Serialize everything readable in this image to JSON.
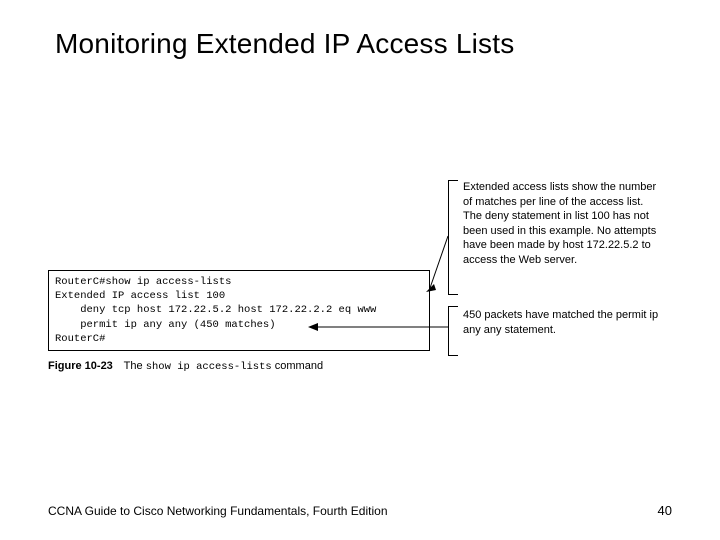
{
  "title": "Monitoring Extended IP Access Lists",
  "terminal": {
    "l1": "RouterC#show ip access-lists",
    "l2": "Extended IP access list 100",
    "l3": "    deny tcp host 172.22.5.2 host 172.22.2.2 eq www",
    "l4": "    permit ip any any (450 matches)",
    "l5": "RouterC#"
  },
  "annotations": {
    "top": "Extended access lists show the number of matches per line of the access list. The deny statement in list 100 has not been used in this example. No attempts have been made by host 172.22.5.2 to access the Web server.",
    "bottom": "450 packets have matched the permit ip any any statement."
  },
  "figure": {
    "number": "Figure 10-23",
    "text_prefix": "The ",
    "command": "show ip access-lists",
    "text_suffix": " command"
  },
  "footer": {
    "left": "CCNA Guide to Cisco Networking Fundamentals, Fourth Edition",
    "page": "40"
  }
}
